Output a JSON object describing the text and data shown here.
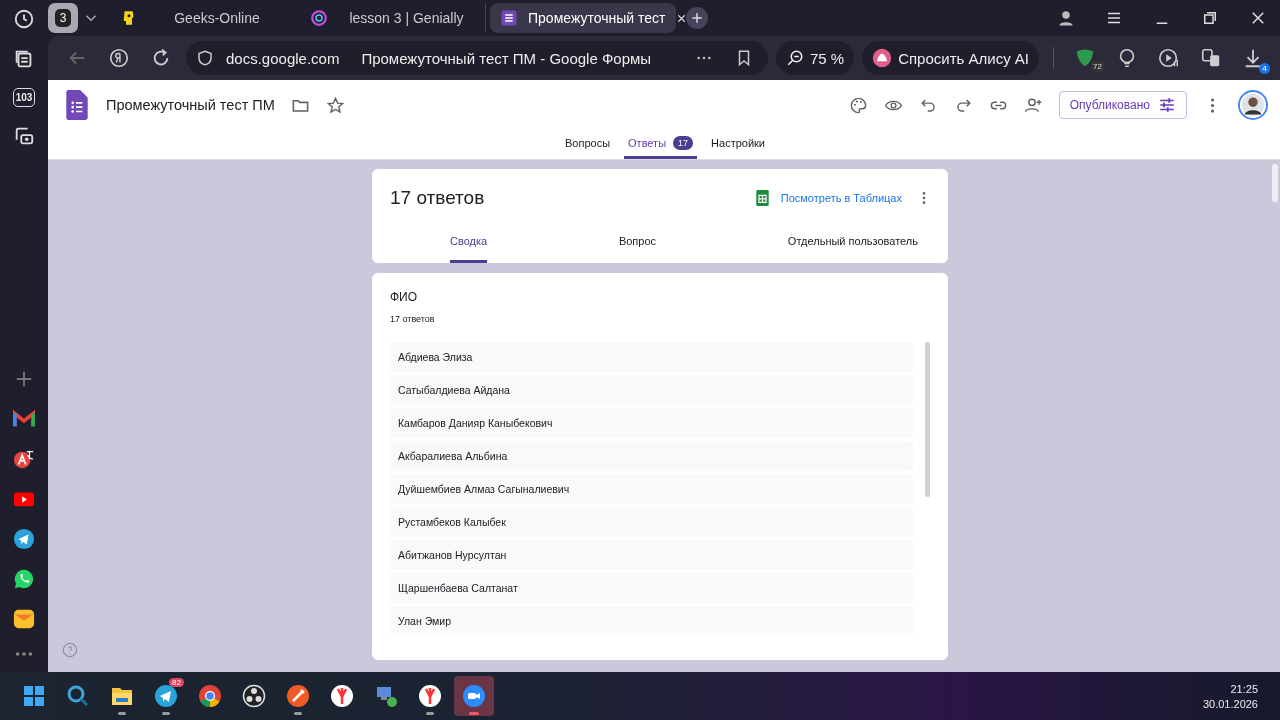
{
  "browser": {
    "tab_counter": "3",
    "tabs": [
      {
        "label": "Geeks-Online",
        "kind": "geeks",
        "selected": false
      },
      {
        "label": "lesson 3 | Genially",
        "kind": "genially",
        "selected": false
      },
      {
        "label": "Промежуточный тест",
        "kind": "forms",
        "selected": true
      }
    ],
    "domain": "docs.google.com",
    "page_title": "Промежуточный тест ПМ - Google Формы",
    "zoom": "75 %",
    "assistant": "Спросить Алису AI",
    "extension_badge": "72",
    "downloads_badge": "4"
  },
  "sidebar": {
    "counter": "103"
  },
  "form": {
    "title": "Промежуточный тест ПМ",
    "tabs": [
      {
        "label": "Вопросы",
        "selected": false
      },
      {
        "label": "Ответы",
        "count": "17",
        "selected": true
      },
      {
        "label": "Настройки",
        "selected": false
      }
    ],
    "publish_button": "Опубликовано"
  },
  "summary": {
    "title": "17 ответов",
    "sheets_link": "Посмотреть в Таблицах",
    "tabs": [
      {
        "label": "Сводка",
        "selected": true
      },
      {
        "label": "Вопрос",
        "selected": false
      },
      {
        "label": "Отдельный пользователь",
        "selected": false
      }
    ]
  },
  "question": {
    "title": "ФИО",
    "count": "17 ответов",
    "answers": [
      "Абдиева Элиза",
      "Сатыбалдиева Айдана",
      "Камбаров Данияр Каныбекович",
      "Акбаралиева Альбина",
      "Дуйшембиев Алмаз Сагыналиевич",
      "Рустамбеков Калыбек",
      "Абитжанов Нурсултан",
      "Щаршенбаева Салтанат",
      "Улан Эмир"
    ]
  },
  "taskbar": {
    "apps": [
      {
        "kind": "windows",
        "running": false,
        "selected": false
      },
      {
        "kind": "search",
        "running": false,
        "selected": false
      },
      {
        "kind": "folder",
        "running": true,
        "selected": false
      },
      {
        "kind": "telegram",
        "running": true,
        "selected": false,
        "badge": "82"
      },
      {
        "kind": "chrome",
        "running": false,
        "selected": false
      },
      {
        "kind": "obs",
        "running": false,
        "selected": false
      },
      {
        "kind": "postman",
        "running": true,
        "selected": false
      },
      {
        "kind": "yandex",
        "running": false,
        "selected": false
      },
      {
        "kind": "network",
        "running": false,
        "selected": false
      },
      {
        "kind": "yandex",
        "running": true,
        "selected": false
      },
      {
        "kind": "zoom",
        "running": true,
        "selected": true
      }
    ],
    "time": "21:25",
    "date": "30.01.2026"
  }
}
